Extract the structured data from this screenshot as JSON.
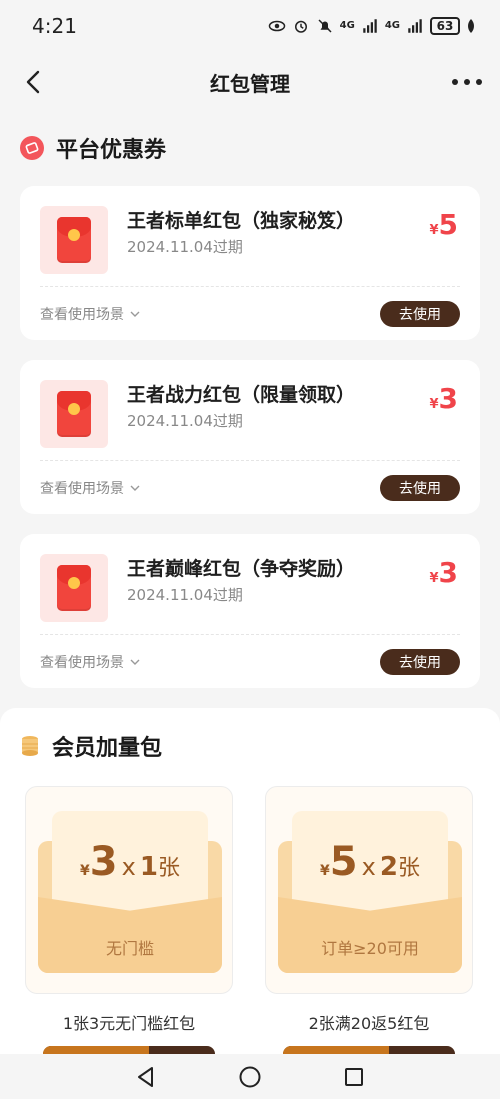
{
  "status_bar": {
    "time": "4:21",
    "signal_1": "4G",
    "signal_2": "4G",
    "battery": "63"
  },
  "nav": {
    "title": "红包管理"
  },
  "coupons_section": {
    "title": "平台优惠券",
    "items": [
      {
        "name": "王者标单红包（独家秘笈）",
        "expiry": "2024.11.04过期",
        "currency": "¥",
        "value": "5",
        "scene_label": "查看使用场景",
        "action": "去使用"
      },
      {
        "name": "王者战力红包（限量领取）",
        "expiry": "2024.11.04过期",
        "currency": "¥",
        "value": "3",
        "scene_label": "查看使用场景",
        "action": "去使用"
      },
      {
        "name": "王者巅峰红包（争夺奖励）",
        "expiry": "2024.11.04过期",
        "currency": "¥",
        "value": "3",
        "scene_label": "查看使用场景",
        "action": "去使用"
      }
    ]
  },
  "member_section": {
    "title": "会员加量包",
    "packs": [
      {
        "currency": "¥",
        "amount": "3",
        "times": "x",
        "count": "1",
        "unit": "张",
        "condition": "无门槛",
        "caption": "1张3元无门槛红包"
      },
      {
        "currency": "¥",
        "amount": "5",
        "times": "x",
        "count": "2",
        "unit": "张",
        "condition": "订单≥20可用",
        "caption": "2张满20返5红包"
      }
    ]
  },
  "colors": {
    "accent_red": "#f0444a",
    "button_brown": "#4a2c1c",
    "pack_gold": "#9a5a23"
  }
}
